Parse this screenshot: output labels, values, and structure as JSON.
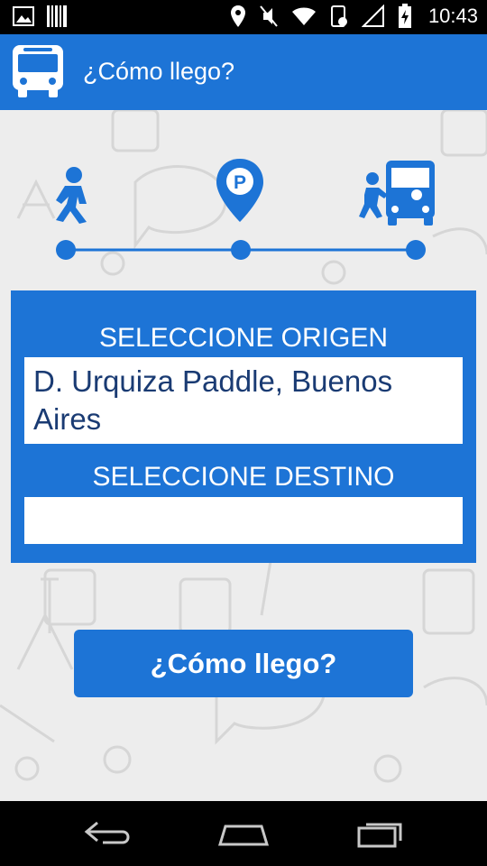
{
  "status_bar": {
    "time": "10:43",
    "icons": [
      "image-icon",
      "barcode-icon",
      "location-icon",
      "mute-icon",
      "wifi-icon",
      "phone-icon",
      "signal-icon",
      "battery-icon"
    ]
  },
  "app_bar": {
    "title": "¿Cómo llego?",
    "icon": "bus-icon"
  },
  "form": {
    "origin_label": "SELECCIONE ORIGEN",
    "origin_value": "D. Urquiza Paddle, Buenos Aires",
    "destination_label": "SELECCIONE DESTINO",
    "destination_value": ""
  },
  "action_button": {
    "label": "¿Cómo llego?"
  },
  "steps": {
    "icons": [
      "walking-person-icon",
      "parking-pin-icon",
      "boarding-bus-icon"
    ]
  },
  "nav_bar": {
    "icons": [
      "back-icon",
      "home-icon",
      "recents-icon"
    ]
  },
  "colors": {
    "primary": "#1d74d6",
    "background": "#ededed",
    "text_dark": "#1a3b73"
  }
}
